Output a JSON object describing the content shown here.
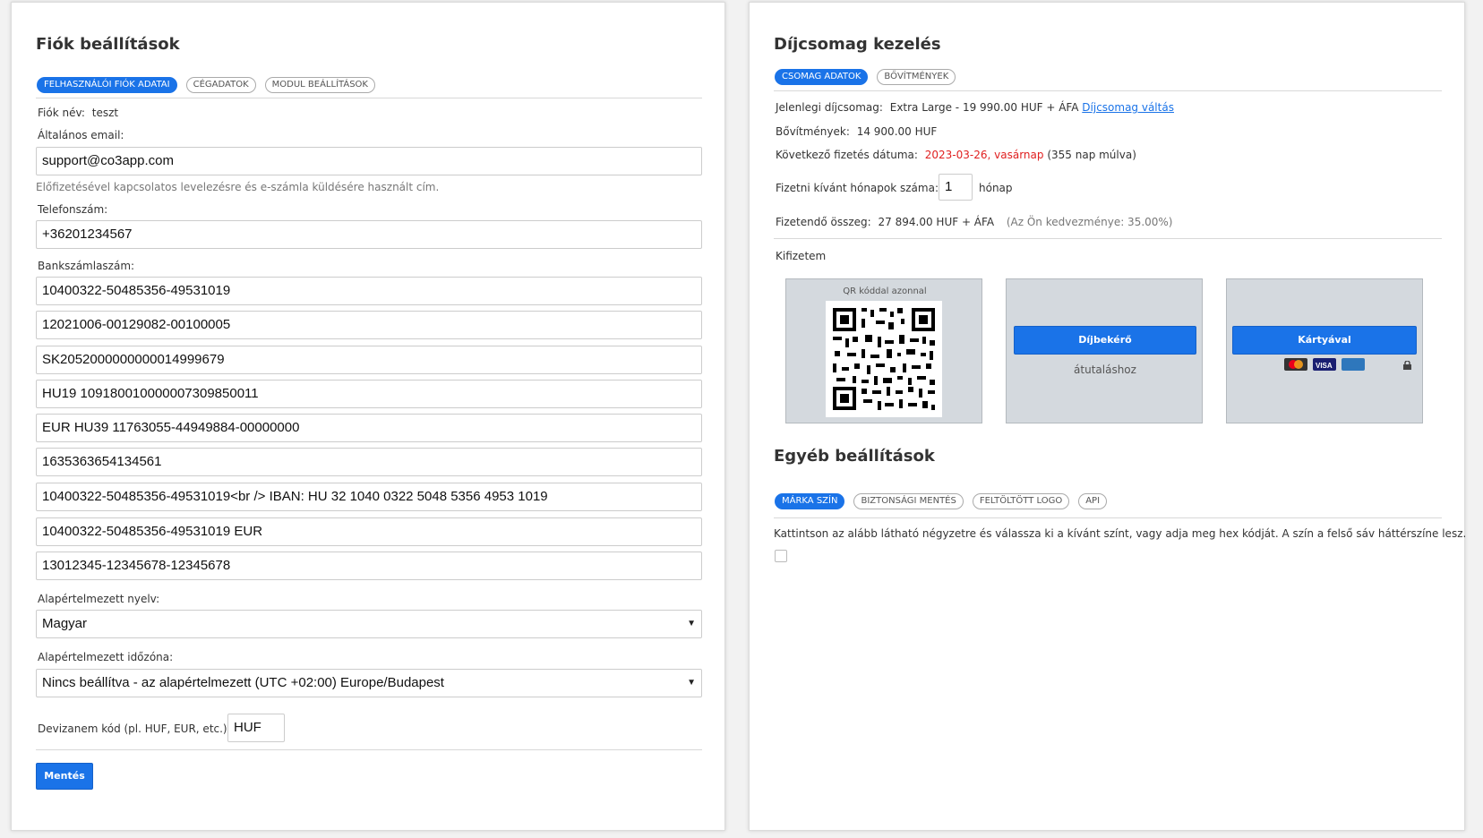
{
  "left": {
    "title": "Fiók beállítások",
    "tabs": [
      "FELHASZNÁLÓI FIÓK ADATAI",
      "CÉGADATOK",
      "MODUL BEÁLLÍTÁSOK"
    ],
    "account_name_label": "Fiók név:",
    "account_name_value": "teszt",
    "email_label": "Általános email:",
    "email_value": "support@co3app.com",
    "email_help": "Előfizetésével kapcsolatos levelezésre és e-számla küldésére használt cím.",
    "phone_label": "Telefonszám:",
    "phone_value": "+36201234567",
    "bank_label": "Bankszámlaszám:",
    "bank_accounts": [
      "10400322-50485356-49531019",
      "12021006-00129082-00100005",
      "SK2052000000000014999679",
      "HU19 10918001000000730985001​1",
      "EUR HU39 11763055-44949884-00000000",
      "1635363654134561",
      "10400322-50485356-49531019<br /> IBAN: HU 32 1040 0322 5048 5356 4953 1019",
      "10400322-50485356-49531019 EUR",
      "13012345-12345678-12345678"
    ],
    "language_label": "Alapértelmezett nyelv:",
    "language_value": "Magyar",
    "timezone_label": "Alapértelmezett időzóna:",
    "timezone_value": "Nincs beállítva - az alapértelmezett (UTC +02:00) Europe/Budapest",
    "currency_label": "Devizanem kód (pl. HUF, EUR, etc.):",
    "currency_value": "HUF",
    "save_label": "Mentés"
  },
  "right": {
    "title": "Díjcsomag kezelés",
    "tabs": [
      "CSOMAG ADATOK",
      "BŐVÍTMÉNYEK"
    ],
    "current_plan_label": "Jelenlegi díjcsomag:",
    "current_plan_value": "Extra Large - 19 990.00 HUF + ÁFA",
    "change_plan_link": "Díjcsomag váltás",
    "addons_label": "Bővítmények:",
    "addons_value": "14 900.00 HUF",
    "next_payment_label": "Következő fizetés dátuma:",
    "next_payment_date": "2023-03-26, vasárnap",
    "next_payment_note": "(355 nap múlva)",
    "months_label": "Fizetni kívánt hónapok száma:",
    "months_value": "1",
    "months_unit": "hónap",
    "total_label": "Fizetendő összeg:",
    "total_value": "27 894.00 HUF + ÁFA",
    "discount_note": "(Az Ön kedvezménye: 35.00%)",
    "pay_label": "Kifizetem",
    "qr_caption": "QR kóddal azonnal",
    "invoice_button": "Díjbekérő",
    "invoice_note": "átutaláshoz",
    "card_button": "Kártyával",
    "card_brands": [
      "mastercard",
      "visa",
      "american-express"
    ],
    "other_title": "Egyéb beállítások",
    "other_tabs": [
      "MÁRKA SZÍN",
      "BIZTONSÁGI MENTÉS",
      "FELTÖLTÖTT LOGO",
      "API"
    ],
    "color_help": "Kattintson az alább látható négyzetre és válassza ki a kívánt színt, vagy adja meg hex kódját. A szín a felső sáv háttérszíne lesz."
  },
  "colors": {
    "accent": "#1a73e8",
    "date": "#e02020"
  }
}
